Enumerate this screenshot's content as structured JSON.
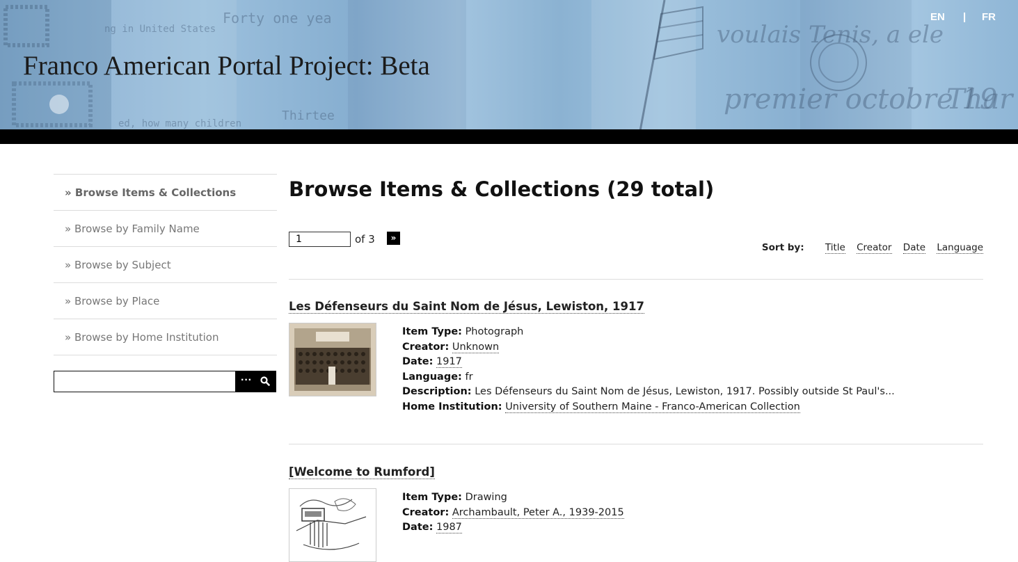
{
  "header": {
    "site_title": "Franco American Portal Project: Beta",
    "lang_en": "EN",
    "lang_separator": "|",
    "lang_fr": "FR"
  },
  "sidebar": {
    "items": [
      {
        "label": "» Browse Items & Collections",
        "active": true
      },
      {
        "label": "» Browse by Family Name",
        "active": false
      },
      {
        "label": "» Browse by Subject",
        "active": false
      },
      {
        "label": "» Browse by Place",
        "active": false
      },
      {
        "label": "» Browse by Home Institution",
        "active": false
      }
    ],
    "search": {
      "value": "",
      "placeholder": "",
      "options_icon": "ellipsis-icon",
      "submit_icon": "search-icon"
    }
  },
  "main": {
    "title": "Browse Items & Collections (29 total)",
    "pagination": {
      "current_page": "1",
      "of_text": "of 3",
      "next_label": "»"
    },
    "sort": {
      "label": "Sort by:",
      "options": [
        "Title",
        "Creator",
        "Date",
        "Language"
      ]
    },
    "items": [
      {
        "title": "Les Défenseurs du Saint Nom de Jésus, Lewiston, 1917",
        "fields": [
          {
            "label": "Item Type:",
            "value": "Photograph",
            "link": false
          },
          {
            "label": "Creator:",
            "value": "Unknown",
            "link": true
          },
          {
            "label": "Date:",
            "value": "1917",
            "link": true
          },
          {
            "label": "Language:",
            "value": "fr",
            "link": false
          },
          {
            "label": "Description:",
            "value": "Les Défenseurs du Saint Nom de Jésus, Lewiston, 1917. Possibly outside St Paul's...",
            "link": false
          },
          {
            "label": "Home Institution:",
            "value": "University of Southern Maine - Franco-American Collection",
            "link": true
          }
        ]
      },
      {
        "title": "[Welcome to Rumford]",
        "fields": [
          {
            "label": "Item Type:",
            "value": "Drawing",
            "link": false
          },
          {
            "label": "Creator:",
            "value": "Archambault, Peter A., 1939-2015",
            "link": true
          },
          {
            "label": "Date:",
            "value": "1987",
            "link": true
          }
        ]
      }
    ]
  }
}
